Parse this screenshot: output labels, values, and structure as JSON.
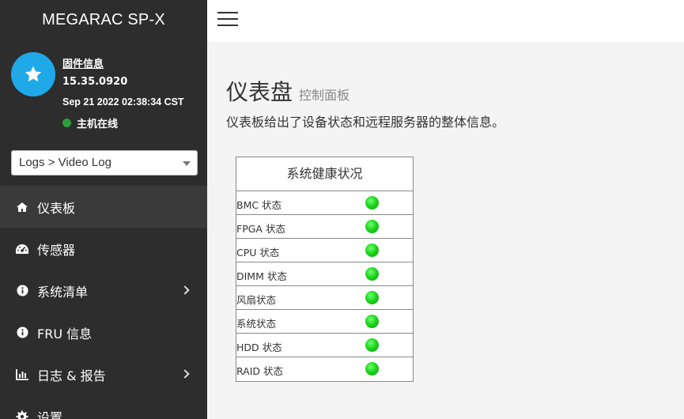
{
  "app": {
    "brand": "MEGARAC SP-X"
  },
  "user_panel": {
    "fw_title": "固件信息",
    "fw_version": "15.35.0920",
    "fw_date": "Sep 21 2022 02:38:34 CST",
    "host_status": "主机在线"
  },
  "quick_nav": {
    "selected": "Logs > Video Log"
  },
  "menu": {
    "items": [
      {
        "label": "仪表板",
        "icon": "home-icon",
        "active": true
      },
      {
        "label": "传感器",
        "icon": "gauge-icon"
      },
      {
        "label": "系统清单",
        "icon": "info-icon",
        "submenu": true
      },
      {
        "label": "FRU 信息",
        "icon": "info-icon"
      },
      {
        "label": "日志 & 报告",
        "icon": "bar-chart-icon",
        "submenu": true
      },
      {
        "label": "设置",
        "icon": "gear-icon"
      }
    ]
  },
  "page": {
    "title": "仪表盘",
    "subtitle": "控制面板",
    "description": "仪表板给出了设备状态和远程服务器的整体信息。"
  },
  "health": {
    "title": "系统健康状况",
    "rows": [
      {
        "label": "BMC 状态",
        "status": "ok"
      },
      {
        "label": "FPGA 状态",
        "status": "ok"
      },
      {
        "label": "CPU 状态",
        "status": "ok"
      },
      {
        "label": "DIMM 状态",
        "status": "ok"
      },
      {
        "label": "风扇状态",
        "status": "ok"
      },
      {
        "label": "系统状态",
        "status": "ok"
      },
      {
        "label": "HDD 状态",
        "status": "ok"
      },
      {
        "label": "RAID 状态",
        "status": "ok"
      }
    ]
  },
  "colors": {
    "sidebar": "#2d2d2d",
    "accent": "#1fa9e8",
    "online": "#2e9b3a",
    "led_ok": "#1ed61e"
  }
}
